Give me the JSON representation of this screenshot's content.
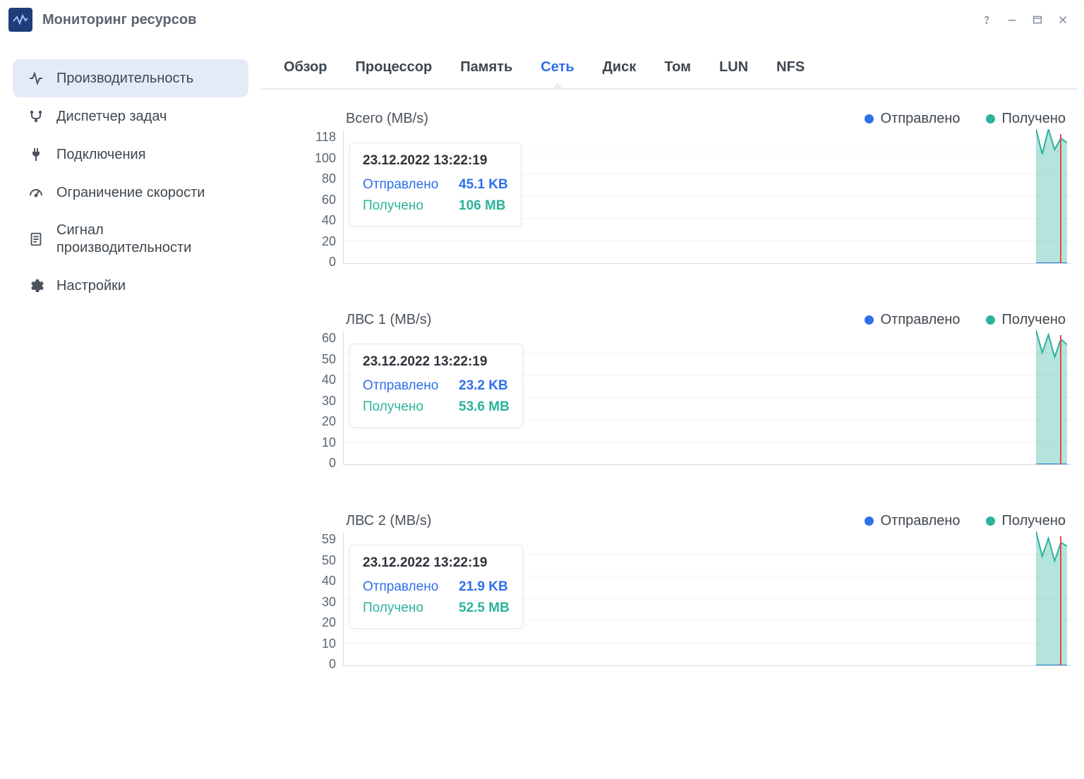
{
  "window": {
    "title": "Мониторинг ресурсов"
  },
  "sidebar": {
    "items": [
      {
        "label": "Производительность"
      },
      {
        "label": "Диспетчер задач"
      },
      {
        "label": "Подключения"
      },
      {
        "label": "Ограничение скорости"
      },
      {
        "label": "Сигнал производительности"
      },
      {
        "label": "Настройки"
      }
    ]
  },
  "tabs": [
    {
      "label": "Обзор"
    },
    {
      "label": "Процессор"
    },
    {
      "label": "Память"
    },
    {
      "label": "Сеть"
    },
    {
      "label": "Диск"
    },
    {
      "label": "Том"
    },
    {
      "label": "LUN"
    },
    {
      "label": "NFS"
    }
  ],
  "legend": {
    "sent": "Отправлено",
    "recv": "Получено"
  },
  "colors": {
    "sent": "#2f6fea",
    "recv": "#2bb39a",
    "marker": "#e14b4b"
  },
  "charts": [
    {
      "title": "Всего (MB/s)",
      "tooltip": {
        "ts": "23.12.2022 13:22:19",
        "sent_label": "Отправлено",
        "sent_value": "45.1 KB",
        "recv_label": "Получено",
        "recv_value": "106 MB"
      }
    },
    {
      "title": "ЛВС 1 (MB/s)",
      "tooltip": {
        "ts": "23.12.2022 13:22:19",
        "sent_label": "Отправлено",
        "sent_value": "23.2 KB",
        "recv_label": "Получено",
        "recv_value": "53.6 MB"
      }
    },
    {
      "title": "ЛВС 2 (MB/s)",
      "tooltip": {
        "ts": "23.12.2022 13:22:19",
        "sent_label": "Отправлено",
        "sent_value": "21.9 KB",
        "recv_label": "Получено",
        "recv_value": "52.5 MB"
      }
    }
  ],
  "chart_data": [
    {
      "type": "line",
      "title": "Всего (MB/s)",
      "xlabel": "",
      "ylabel": "MB/s",
      "ylim": [
        0,
        118
      ],
      "yticks": [
        0,
        20,
        40,
        60,
        80,
        100,
        118
      ],
      "series": [
        {
          "name": "Отправлено",
          "color": "#2f6fea",
          "values_tail": [
            0.04,
            0.04,
            0.04,
            0.04,
            0.04,
            0.04
          ],
          "latest_display": "45.1 KB"
        },
        {
          "name": "Получено",
          "color": "#2bb39a",
          "values_tail": [
            118,
            96,
            118,
            100,
            110,
            106
          ],
          "latest_display": "106 MB"
        }
      ],
      "marker_time": "23.12.2022 13:22:19"
    },
    {
      "type": "line",
      "title": "ЛВС 1 (MB/s)",
      "xlabel": "",
      "ylabel": "MB/s",
      "ylim": [
        0,
        60
      ],
      "yticks": [
        0,
        10,
        20,
        30,
        40,
        50,
        60
      ],
      "series": [
        {
          "name": "Отправлено",
          "color": "#2f6fea",
          "values_tail": [
            0.02,
            0.02,
            0.02,
            0.02,
            0.02,
            0.02
          ],
          "latest_display": "23.2 KB"
        },
        {
          "name": "Получено",
          "color": "#2bb39a",
          "values_tail": [
            60,
            50,
            58,
            48,
            56,
            53.6
          ],
          "latest_display": "53.6 MB"
        }
      ],
      "marker_time": "23.12.2022 13:22:19"
    },
    {
      "type": "line",
      "title": "ЛВС 2 (MB/s)",
      "xlabel": "",
      "ylabel": "MB/s",
      "ylim": [
        0,
        59
      ],
      "yticks": [
        0,
        10,
        20,
        30,
        40,
        50,
        59
      ],
      "series": [
        {
          "name": "Отправлено",
          "color": "#2f6fea",
          "values_tail": [
            0.02,
            0.02,
            0.02,
            0.02,
            0.02,
            0.02
          ],
          "latest_display": "21.9 KB"
        },
        {
          "name": "Получено",
          "color": "#2bb39a",
          "values_tail": [
            59,
            48,
            56,
            46,
            54,
            52.5
          ],
          "latest_display": "52.5 MB"
        }
      ],
      "marker_time": "23.12.2022 13:22:19"
    }
  ]
}
